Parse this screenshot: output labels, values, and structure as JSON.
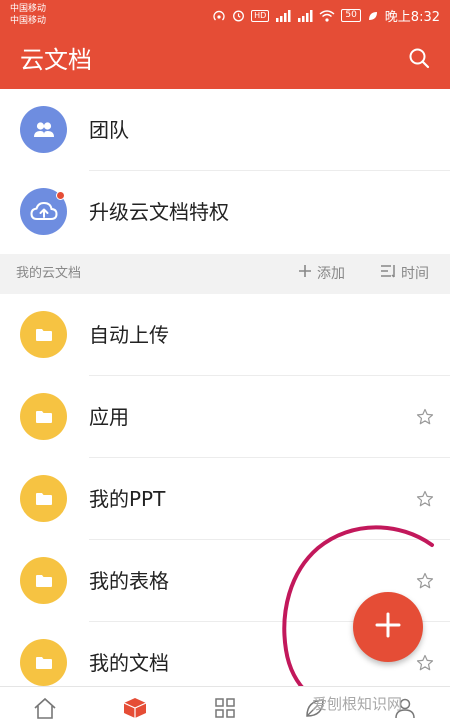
{
  "status_bar": {
    "carrier_1": "中国移动",
    "carrier_2": "中国移动",
    "sim_badge": "HD",
    "battery": "50",
    "time": "晚上8:32"
  },
  "header": {
    "title": "云文档",
    "search_icon": "search-icon"
  },
  "top_items": [
    {
      "label": "团队",
      "icon": "team-icon",
      "color": "#6e8de0"
    },
    {
      "label": "升级云文档特权",
      "icon": "cloud-upload-icon",
      "color": "#6e8de0",
      "badge_color": "#e54d36"
    }
  ],
  "section": {
    "title": "我的云文档",
    "add_label": "添加",
    "sort_label": "时间"
  },
  "folders": [
    {
      "label": "自动上传",
      "starred": false,
      "show_star": false
    },
    {
      "label": "应用",
      "starred": false,
      "show_star": true
    },
    {
      "label": "我的PPT",
      "starred": false,
      "show_star": true
    },
    {
      "label": "我的表格",
      "starred": false,
      "show_star": true
    },
    {
      "label": "我的文档",
      "starred": false,
      "show_star": true
    }
  ],
  "fab": {
    "icon": "plus-icon"
  },
  "bottom_nav": [
    {
      "icon": "home-icon"
    },
    {
      "icon": "cloud-box-icon",
      "active": true
    },
    {
      "icon": "apps-grid-icon"
    },
    {
      "icon": "leaf-icon"
    },
    {
      "icon": "profile-icon"
    }
  ],
  "watermark": "爱刨根知识网",
  "colors": {
    "brand": "#e54d36",
    "folder": "#f6c342",
    "team": "#6e8de0",
    "annotation": "#c2185b"
  }
}
